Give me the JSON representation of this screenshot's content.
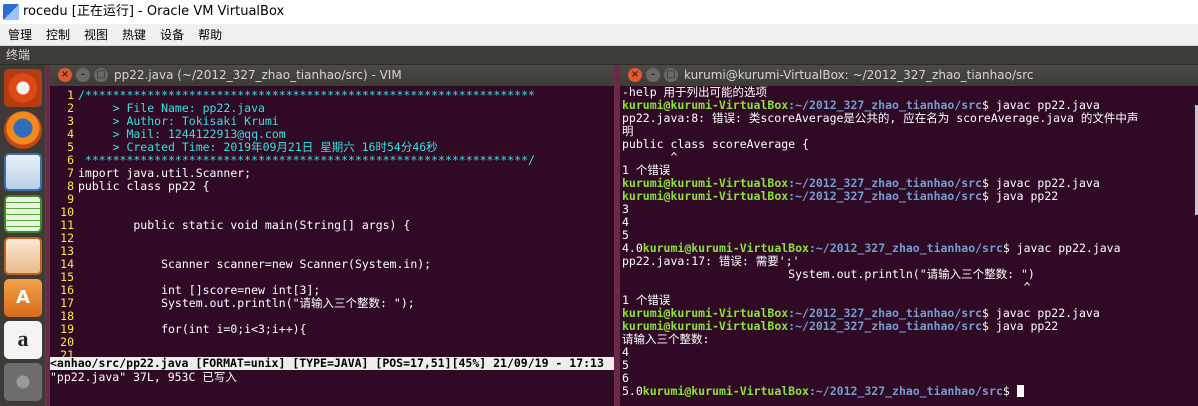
{
  "vbox": {
    "title": "rocedu [正在运行] - Oracle VM VirtualBox",
    "menu": [
      "管理",
      "控制",
      "视图",
      "热键",
      "设备",
      "帮助"
    ]
  },
  "guest": {
    "topbar_label": "终端"
  },
  "launcher": [
    "ubuntu-dash-icon",
    "firefox-icon",
    "libreoffice-writer-icon",
    "libreoffice-calc-icon",
    "libreoffice-impress-icon",
    "software-center-icon",
    "amazon-icon",
    "settings-icon"
  ],
  "vim": {
    "title": "pp22.java (~/2012_327_zhao_tianhao/src) - VIM",
    "lines": [
      {
        "n": "1",
        "t": "/*****************************************************************"
      },
      {
        "n": "2",
        "t": "     > File Name: pp22.java"
      },
      {
        "n": "3",
        "t": "     > Author: Tokisaki Krumi"
      },
      {
        "n": "4",
        "t": "     > Mail: 1244122913@qq.com"
      },
      {
        "n": "5",
        "t": "     > Created Time: 2019年09月21日 星期六 16时54分46秒"
      },
      {
        "n": "6",
        "t": " ****************************************************************/"
      },
      {
        "n": "7",
        "t": "import java.util.Scanner;"
      },
      {
        "n": "8",
        "t": "public class pp22 {"
      },
      {
        "n": "9",
        "t": ""
      },
      {
        "n": "10",
        "t": ""
      },
      {
        "n": "11",
        "t": "        public static void main(String[] args) {"
      },
      {
        "n": "12",
        "t": ""
      },
      {
        "n": "13",
        "t": ""
      },
      {
        "n": "14",
        "t": "            Scanner scanner=new Scanner(System.in);"
      },
      {
        "n": "15",
        "t": ""
      },
      {
        "n": "16",
        "t": "            int []score=new int[3];"
      },
      {
        "n": "17",
        "t": "            System.out.println(\"请输入三个整数: \");"
      },
      {
        "n": "18",
        "t": ""
      },
      {
        "n": "19",
        "t": "            for(int i=0;i<3;i++){"
      },
      {
        "n": "20",
        "t": ""
      },
      {
        "n": "21",
        "t": ""
      }
    ],
    "status": "<anhao/src/pp22.java [FORMAT=unix] [TYPE=JAVA] [POS=17,51][45%] 21/09/19 - 17:13",
    "message": "\"pp22.java\" 37L, 953C 已写入"
  },
  "terminal": {
    "title": "kurumi@kurumi-VirtualBox: ~/2012_327_zhao_tianhao/src",
    "prompt_user": "kurumi@kurumi-VirtualBox",
    "prompt_path": ":~/2012_327_zhao_tianhao/src",
    "lines": [
      {
        "pre": "-help 用于列出可能的选项",
        "cmd": null
      },
      {
        "pre": "",
        "cmd": "$ javac pp22.java"
      },
      {
        "pre": "pp22.java:8: 错误: 类scoreAverage是公共的, 应在名为 scoreAverage.java 的文件中声",
        "cmd": null
      },
      {
        "pre": "明",
        "cmd": null
      },
      {
        "pre": "public class scoreAverage {",
        "cmd": null
      },
      {
        "pre": "       ^",
        "cmd": null
      },
      {
        "pre": "1 个错误",
        "cmd": null
      },
      {
        "pre": "",
        "cmd": "$ javac pp22.java"
      },
      {
        "pre": "",
        "cmd": "$ java pp22"
      },
      {
        "pre": "3",
        "cmd": null
      },
      {
        "pre": "4",
        "cmd": null
      },
      {
        "pre": "5",
        "cmd": null
      },
      {
        "pre": "4.0",
        "cmd": "$ javac pp22.java"
      },
      {
        "pre": "pp22.java:17: 错误: 需要';'",
        "cmd": null
      },
      {
        "pre": "                        System.out.println(\"请输入三个整数: \")",
        "cmd": null
      },
      {
        "pre": "                                                          ^",
        "cmd": null
      },
      {
        "pre": "1 个错误",
        "cmd": null
      },
      {
        "pre": "",
        "cmd": "$ javac pp22.java"
      },
      {
        "pre": "",
        "cmd": "$ java pp22"
      },
      {
        "pre": "请输入三个整数:",
        "cmd": null
      },
      {
        "pre": "4",
        "cmd": null
      },
      {
        "pre": "5",
        "cmd": null
      },
      {
        "pre": "6",
        "cmd": null
      },
      {
        "pre": "5.0",
        "cmd": "$ "
      }
    ]
  }
}
